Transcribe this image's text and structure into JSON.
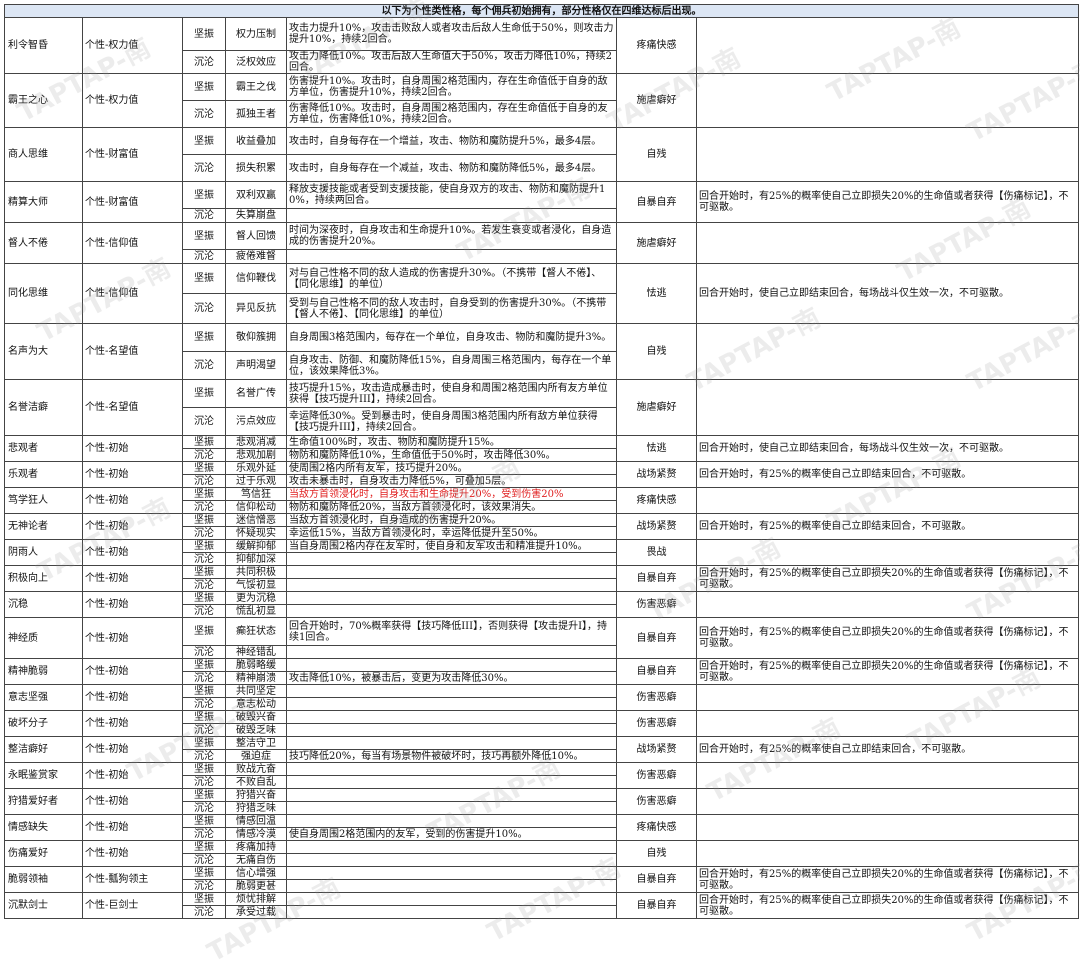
{
  "title": "以下为个性类性格，每个佣兵初始拥有，部分性格仅在四维达标后出现。",
  "watermark": "TAPTAP-南",
  "traits": [
    {
      "name": "利令智昏",
      "type": "个性-权力值",
      "h": [
        33,
        21
      ],
      "rows": [
        {
          "sw": "坚振",
          "sk": "权力压制",
          "desc": "攻击力提升10%，攻击击败敌人或者攻击后敌人生命低于50%，则攻击力提升10%，持续2回合。"
        },
        {
          "sw": "沉沦",
          "sk": "泛权效应",
          "desc": "攻击力降低10%。攻击后敌人生命值大于50%，攻击力降低10%，持续2回合。"
        }
      ],
      "result": "疼痛快感",
      "extra": ""
    },
    {
      "name": "霸王之心",
      "type": "个性-权力值",
      "h": [
        27,
        27
      ],
      "rows": [
        {
          "sw": "坚振",
          "sk": "霸王之伐",
          "desc": "伤害提升10%。攻击时，自身周围2格范围内，存在生命值低于自身的敌方单位，伤害提升10%，持续2回合。"
        },
        {
          "sw": "沉沦",
          "sk": "孤独王者",
          "desc": "伤害降低10%。攻击时，自身周围2格范围内，存在生命值低于自身的友方单位，伤害降低10%，持续2回合。"
        }
      ],
      "result": "施虐癖好",
      "extra": ""
    },
    {
      "name": "商人思维",
      "type": "个性-财富值",
      "h": [
        27,
        27
      ],
      "rows": [
        {
          "sw": "坚振",
          "sk": "收益叠加",
          "desc": "攻击时，自身每存在一个增益，攻击、物防和魔防提升5%，最多4层。"
        },
        {
          "sw": "沉沦",
          "sk": "损失积累",
          "desc": "攻击时，自身每存在一个减益，攻击、物防和魔防降低5%，最多4层。"
        }
      ],
      "result": "自残",
      "extra": ""
    },
    {
      "name": "精算大师",
      "type": "个性-财富值",
      "h": [
        27,
        14
      ],
      "rows": [
        {
          "sw": "坚振",
          "sk": "双利双赢",
          "desc": "释放支援技能或者受到支援技能，使自身双方的攻击、物防和魔防提升10%，持续两回合。"
        },
        {
          "sw": "沉沦",
          "sk": "失算崩盘",
          "desc": ""
        }
      ],
      "result": "自暴自弃",
      "extra": "回合开始时，有25%的概率使自己立即损失20%的生命值或者获得【伤痛标记】，不可驱散。"
    },
    {
      "name": "督人不倦",
      "type": "个性-信仰值",
      "h": [
        27,
        14
      ],
      "rows": [
        {
          "sw": "坚振",
          "sk": "督人回馈",
          "desc": "时间为深夜时，自身攻击和生命提升10%。若发生衰变或者浸化，自身造成的伤害提升20%。"
        },
        {
          "sw": "沉沦",
          "sk": "疲倦难督",
          "desc": ""
        }
      ],
      "result": "施虐癖好",
      "extra": ""
    },
    {
      "name": "同化思维",
      "type": "个性-信仰值",
      "h": [
        30,
        30
      ],
      "rows": [
        {
          "sw": "坚振",
          "sk": "信仰鞭伐",
          "desc": "对与自己性格不同的敌人造成的伤害提升30%。（不携带【督人不倦】、【同化思维】的单位）"
        },
        {
          "sw": "沉沦",
          "sk": "异见反抗",
          "desc": "受到与自己性格不同的敌人攻击时，自身受到的伤害提升30%。（不携带【督人不倦】、【同化思维】的单位）"
        }
      ],
      "result": "怯逃",
      "extra": "回合开始时，使自己立即结束回合，每场战斗仅生效一次，不可驱散。"
    },
    {
      "name": "名声为大",
      "type": "个性-名望值",
      "h": [
        28,
        28
      ],
      "rows": [
        {
          "sw": "坚振",
          "sk": "敬仰簇拥",
          "desc": "自身周围3格范围内，每存在一个单位，自身攻击、物防和魔防提升3%。"
        },
        {
          "sw": "沉沦",
          "sk": "声明渴望",
          "desc": "自身攻击、防御、和魔防降低15%，自身周围三格范围内，每存在一个单位，该效果降低3%。"
        }
      ],
      "result": "自残",
      "extra": ""
    },
    {
      "name": "名誉洁癖",
      "type": "个性-名望值",
      "h": [
        28,
        28
      ],
      "rows": [
        {
          "sw": "坚振",
          "sk": "名誉广传",
          "desc": "技巧提升15%，攻击造成暴击时，使自身和周围2格范围内所有友方单位获得【技巧提升III】，持续2回合。"
        },
        {
          "sw": "沉沦",
          "sk": "污点效应",
          "desc": "幸运降低30%。受到暴击时，使自身周围3格范围内所有敌方单位获得【技巧提升III】，持续2回合。"
        }
      ],
      "result": "施虐癖好",
      "extra": ""
    },
    {
      "name": "悲观者",
      "type": "个性-初始",
      "h": [
        13,
        13
      ],
      "rows": [
        {
          "sw": "坚振",
          "sk": "悲观消减",
          "desc": "生命值100%时，攻击、物防和魔防提升15%。"
        },
        {
          "sw": "沉沦",
          "sk": "悲观加剧",
          "desc": "物防和魔防降低10%，生命值低于50%时，攻击降低30%。"
        }
      ],
      "result": "怯逃",
      "extra": "回合开始时，使自己立即结束回合，每场战斗仅生效一次，不可驱散。"
    },
    {
      "name": "乐观者",
      "type": "个性-初始",
      "h": [
        13,
        13
      ],
      "rows": [
        {
          "sw": "坚振",
          "sk": "乐观外延",
          "desc": "使周围2格内所有友军，技巧提升20%。"
        },
        {
          "sw": "沉沦",
          "sk": "过于乐观",
          "desc": "攻击未暴击时，自身攻击力降低5%，可叠加5层。"
        }
      ],
      "result": "战场紧赘",
      "extra": "回合开始时，有25%的概率使自己立即结束回合，不可驱散。"
    },
    {
      "name": "笃学狂人",
      "type": "个性-初始",
      "h": [
        13,
        13
      ],
      "rows": [
        {
          "sw": "坚振",
          "sk": "笃信狂",
          "desc": "当敌方首领浸化时，自身攻击和生命提升20%，受到伤害20%",
          "red": true
        },
        {
          "sw": "沉沦",
          "sk": "信仰松动",
          "desc": "物防和魔防降低20%，当敌方首领浸化时，该效果消失。"
        }
      ],
      "result": "疼痛快感",
      "extra": ""
    },
    {
      "name": "无神论者",
      "type": "个性-初始",
      "h": [
        13,
        13
      ],
      "rows": [
        {
          "sw": "坚振",
          "sk": "迷信憎恶",
          "desc": "当敌方首领浸化时，自身造成的伤害提升20%。"
        },
        {
          "sw": "沉沦",
          "sk": "怀疑现实",
          "desc": "幸运低15%，当敌方首领浸化时，幸运降低提升至50%。"
        }
      ],
      "result": "战场紧赘",
      "extra": "回合开始时，有25%的概率使自己立即结束回合，不可驱散。"
    },
    {
      "name": "阴雨人",
      "type": "个性-初始",
      "h": [
        13,
        13
      ],
      "rows": [
        {
          "sw": "坚振",
          "sk": "缓解抑郁",
          "desc": "当自身周围2格内存在友军时，使自身和友军攻击和精准提升10%。"
        },
        {
          "sw": "沉沦",
          "sk": "抑郁加深",
          "desc": ""
        }
      ],
      "result": "畏战",
      "extra": ""
    },
    {
      "name": "积极向上",
      "type": "个性-初始",
      "h": [
        13,
        13
      ],
      "rows": [
        {
          "sw": "坚振",
          "sk": "共同积极",
          "desc": ""
        },
        {
          "sw": "沉沦",
          "sk": "气馁初显",
          "desc": ""
        }
      ],
      "result": "自暴自弃",
      "extra": "回合开始时，有25%的概率使自己立即损失20%的生命值或者获得【伤痛标记】，不可驱散。"
    },
    {
      "name": "沉稳",
      "type": "个性-初始",
      "h": [
        13,
        13
      ],
      "rows": [
        {
          "sw": "坚振",
          "sk": "更为沉稳",
          "desc": ""
        },
        {
          "sw": "沉沦",
          "sk": "慌乱初显",
          "desc": ""
        }
      ],
      "result": "伤害恶癖",
      "extra": ""
    },
    {
      "name": "神经质",
      "type": "个性-初始",
      "h": [
        28,
        13
      ],
      "rows": [
        {
          "sw": "坚振",
          "sk": "癫狂状态",
          "desc": "回合开始时，70%概率获得【技巧降低III】，否则获得【攻击提升I】，持续1回合。"
        },
        {
          "sw": "沉沦",
          "sk": "神经错乱",
          "desc": ""
        }
      ],
      "result": "自暴自弃",
      "extra": "回合开始时，有25%的概率使自己立即损失20%的生命值或者获得【伤痛标记】，不可驱散。"
    },
    {
      "name": "精神脆弱",
      "type": "个性-初始",
      "h": [
        13,
        13
      ],
      "rows": [
        {
          "sw": "坚振",
          "sk": "脆弱略缓",
          "desc": ""
        },
        {
          "sw": "沉沦",
          "sk": "精神崩溃",
          "desc": "攻击降低10%，被暴击后，变更为攻击降低30%。"
        }
      ],
      "result": "自暴自弃",
      "extra": "回合开始时，有25%的概率使自己立即损失20%的生命值或者获得【伤痛标记】，不可驱散。"
    },
    {
      "name": "意志坚强",
      "type": "个性-初始",
      "h": [
        13,
        13
      ],
      "rows": [
        {
          "sw": "坚振",
          "sk": "共同坚定",
          "desc": ""
        },
        {
          "sw": "沉沦",
          "sk": "意志松动",
          "desc": ""
        }
      ],
      "result": "伤害恶癖",
      "extra": ""
    },
    {
      "name": "破坏分子",
      "type": "个性-初始",
      "h": [
        13,
        13
      ],
      "rows": [
        {
          "sw": "坚振",
          "sk": "破毁兴奋",
          "desc": ""
        },
        {
          "sw": "沉沦",
          "sk": "破毁乏味",
          "desc": ""
        }
      ],
      "result": "伤害恶癖",
      "extra": ""
    },
    {
      "name": "整洁癖好",
      "type": "个性-初始",
      "h": [
        13,
        13
      ],
      "rows": [
        {
          "sw": "坚振",
          "sk": "整洁守卫",
          "desc": ""
        },
        {
          "sw": "沉沦",
          "sk": "强迫症",
          "desc": "技巧降低20%，每当有场景物件被破坏时，技巧再额外降低10%。"
        }
      ],
      "result": "战场紧赘",
      "extra": "回合开始时，有25%的概率使自己立即结束回合，不可驱散。"
    },
    {
      "name": "永眠鉴赏家",
      "type": "个性-初始",
      "h": [
        13,
        13
      ],
      "rows": [
        {
          "sw": "坚振",
          "sk": "败战亢奋",
          "desc": ""
        },
        {
          "sw": "沉沦",
          "sk": "不败自乱",
          "desc": ""
        }
      ],
      "result": "伤害恶癖",
      "extra": ""
    },
    {
      "name": "狩猎爱好者",
      "type": "个性-初始",
      "h": [
        13,
        13
      ],
      "rows": [
        {
          "sw": "坚振",
          "sk": "狩猎兴奋",
          "desc": ""
        },
        {
          "sw": "沉沦",
          "sk": "狩猎乏味",
          "desc": ""
        }
      ],
      "result": "伤害恶癖",
      "extra": ""
    },
    {
      "name": "情感缺失",
      "type": "个性-初始",
      "h": [
        13,
        13
      ],
      "rows": [
        {
          "sw": "坚振",
          "sk": "情感回温",
          "desc": ""
        },
        {
          "sw": "沉沦",
          "sk": "情感冷漠",
          "desc": "使自身周围2格范围内的友军，受到的伤害提升10%。"
        }
      ],
      "result": "疼痛快感",
      "extra": ""
    },
    {
      "name": "伤痛爱好",
      "type": "个性-初始",
      "h": [
        13,
        13
      ],
      "rows": [
        {
          "sw": "坚振",
          "sk": "疼痛加持",
          "desc": ""
        },
        {
          "sw": "沉沦",
          "sk": "无痛自伤",
          "desc": ""
        }
      ],
      "result": "自残",
      "extra": ""
    },
    {
      "name": "脆弱领袖",
      "type": "个性-瓢狗领主",
      "h": [
        13,
        13
      ],
      "rows": [
        {
          "sw": "坚振",
          "sk": "信心增强",
          "desc": ""
        },
        {
          "sw": "沉沦",
          "sk": "脆弱更甚",
          "desc": ""
        }
      ],
      "result": "自暴自弃",
      "extra": "回合开始时，有25%的概率使自己立即损失20%的生命值或者获得【伤痛标记】，不可驱散。"
    },
    {
      "name": "沉默剑士",
      "type": "个性-巨剑士",
      "h": [
        13,
        13
      ],
      "rows": [
        {
          "sw": "坚振",
          "sk": "烦忧排解",
          "desc": ""
        },
        {
          "sw": "沉沦",
          "sk": "承受过载",
          "desc": ""
        }
      ],
      "result": "自暴自弃",
      "extra": "回合开始时，有25%的概率使自己立即损失20%的生命值或者获得【伤痛标记】，不可驱散。"
    }
  ]
}
